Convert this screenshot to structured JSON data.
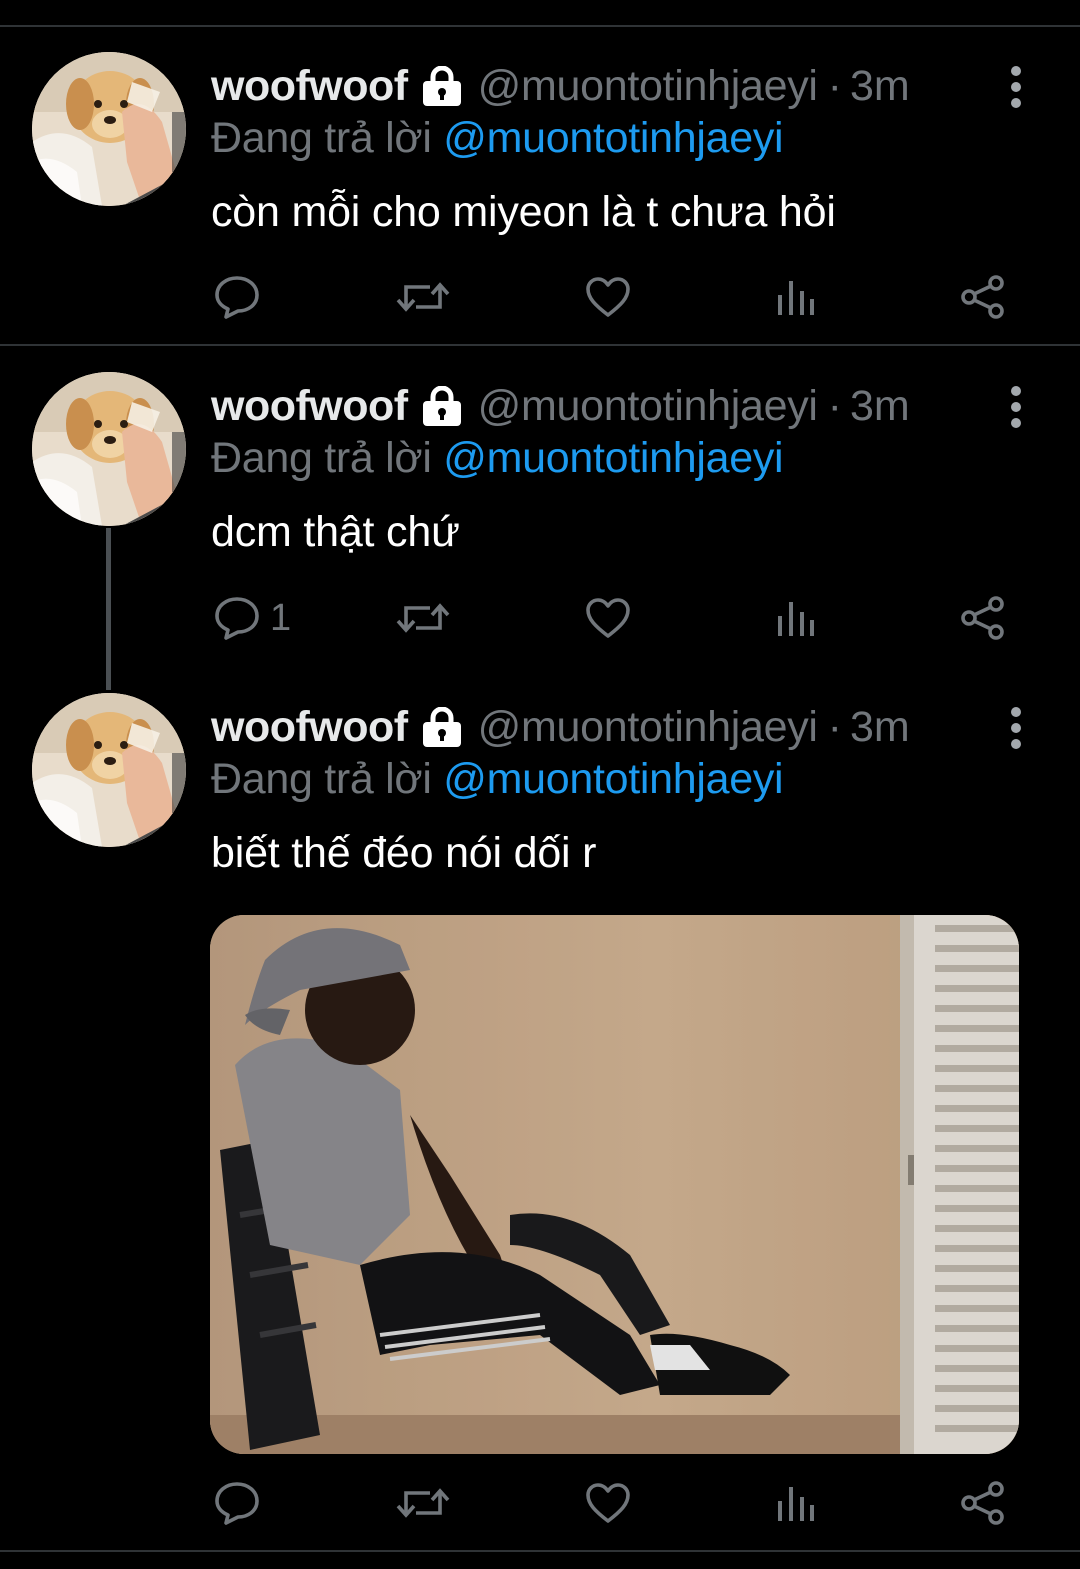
{
  "colors": {
    "background": "#000000",
    "divider": "#2f3336",
    "text_primary": "#ffffff",
    "text_secondary": "#71767b",
    "link": "#1d9bf0"
  },
  "tweets": [
    {
      "display_name": "woofwoof",
      "handle": "@muontotinhjaeyi",
      "separator": "·",
      "time": "3m",
      "reply_prefix": "Đang trả lời",
      "reply_to": "@muontotinhjaeyi",
      "text": "còn mỗi cho miyeon là t chưa hỏi",
      "reply_count": "",
      "icons": [
        "lock-icon",
        "more-icon",
        "reply-icon",
        "retweet-icon",
        "like-icon",
        "views-icon",
        "share-icon"
      ]
    },
    {
      "display_name": "woofwoof",
      "handle": "@muontotinhjaeyi",
      "separator": "·",
      "time": "3m",
      "reply_prefix": "Đang trả lời",
      "reply_to": "@muontotinhjaeyi",
      "text": "dcm thật chứ",
      "reply_count": "1",
      "icons": [
        "lock-icon",
        "more-icon",
        "reply-icon",
        "retweet-icon",
        "like-icon",
        "views-icon",
        "share-icon"
      ]
    },
    {
      "display_name": "woofwoof",
      "handle": "@muontotinhjaeyi",
      "separator": "·",
      "time": "3m",
      "reply_prefix": "Đang trả lời",
      "reply_to": "@muontotinhjaeyi",
      "text": "biết thế đéo nói dối r",
      "reply_count": "",
      "has_media": true,
      "icons": [
        "lock-icon",
        "more-icon",
        "reply-icon",
        "retweet-icon",
        "like-icon",
        "views-icon",
        "share-icon"
      ]
    }
  ]
}
